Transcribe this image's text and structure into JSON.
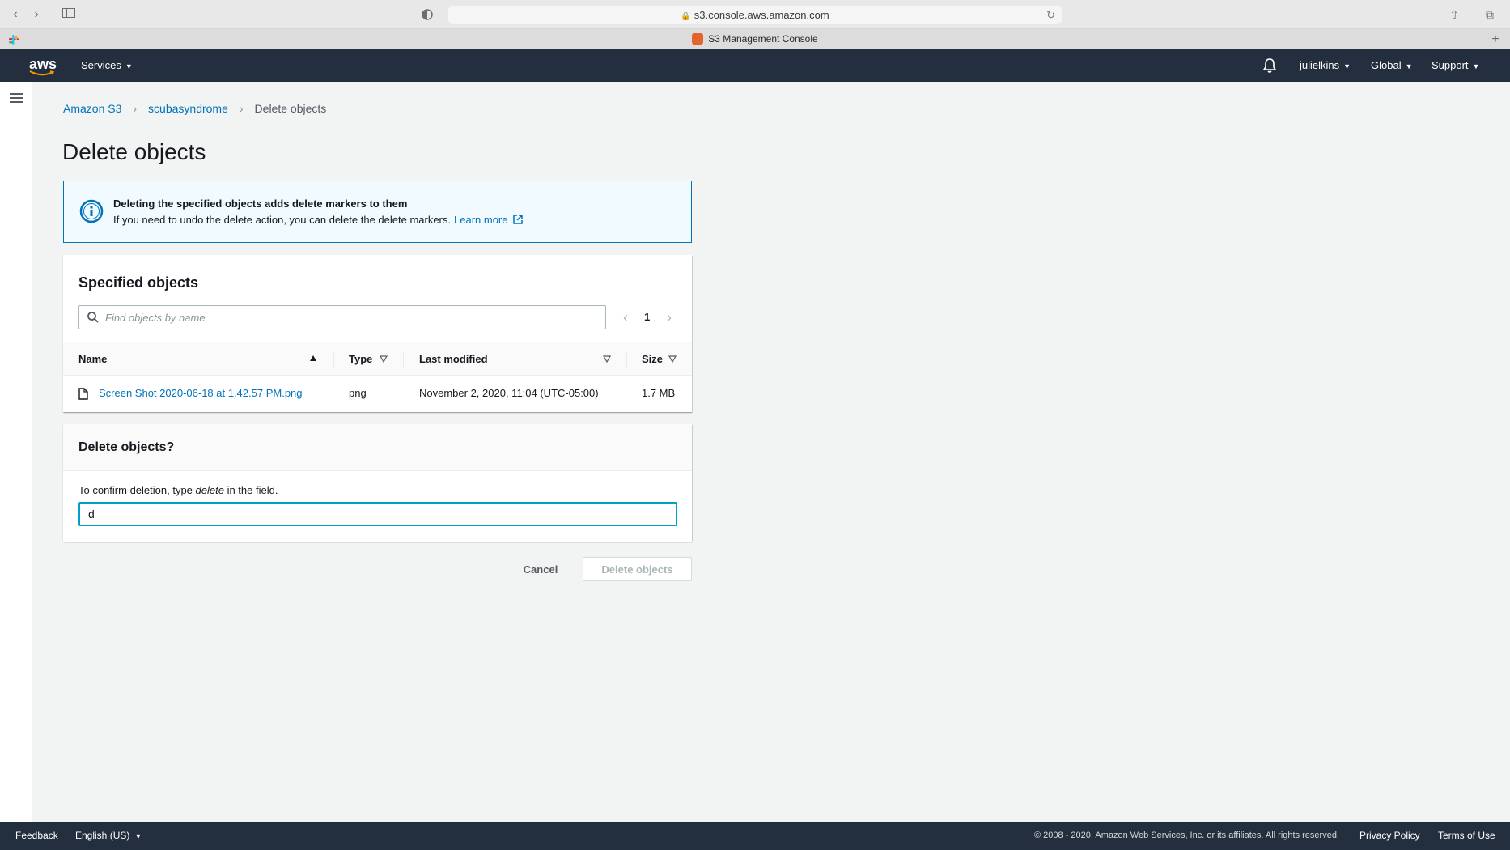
{
  "browser": {
    "url": "s3.console.aws.amazon.com",
    "tab_title": "S3 Management Console"
  },
  "header": {
    "logo_text": "aws",
    "services_label": "Services",
    "user_label": "julielkins",
    "region_label": "Global",
    "support_label": "Support"
  },
  "breadcrumb": {
    "items": [
      "Amazon S3",
      "scubasyndrome"
    ],
    "current": "Delete objects"
  },
  "page_title": "Delete objects",
  "info": {
    "title": "Deleting the specified objects adds delete markers to them",
    "text": "If you need to undo the delete action, you can delete the delete markers.",
    "link": "Learn more"
  },
  "objects_panel": {
    "title": "Specified objects",
    "search_placeholder": "Find objects by name",
    "page_number": "1",
    "columns": [
      "Name",
      "Type",
      "Last modified",
      "Size"
    ],
    "rows": [
      {
        "name": "Screen Shot 2020-06-18 at 1.42.57 PM.png",
        "type": "png",
        "last_modified": "November 2, 2020, 11:04 (UTC-05:00)",
        "size": "1.7 MB"
      }
    ]
  },
  "delete_panel": {
    "title": "Delete objects?",
    "label_before": "To confirm deletion, type",
    "label_keyword": "delete",
    "label_after": "in the field.",
    "input_value": "d"
  },
  "actions": {
    "cancel_label": "Cancel",
    "delete_label": "Delete objects"
  },
  "footer": {
    "feedback": "Feedback",
    "language": "English (US)",
    "copyright": "© 2008 - 2020, Amazon Web Services, Inc. or its affiliates. All rights reserved.",
    "privacy": "Privacy Policy",
    "terms": "Terms of Use"
  },
  "colors": {
    "header_bg": "#232f3e",
    "link": "#0073bb",
    "info_border": "#0073bb",
    "info_bg": "#f1faff",
    "focus_border": "#00a1c9"
  }
}
